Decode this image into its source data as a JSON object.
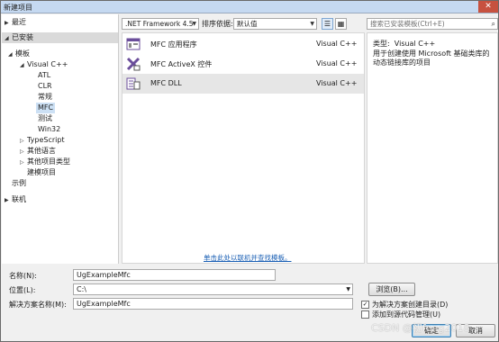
{
  "window": {
    "title": "新建项目",
    "close": "✕"
  },
  "tree": {
    "recent": "最近",
    "installed": "已安装",
    "templates": "模板",
    "visual_cpp": "Visual C++",
    "cpp_children": [
      "ATL",
      "CLR",
      "常规",
      "MFC",
      "测试",
      "Win32"
    ],
    "typescript": "TypeScript",
    "other_languages": "其他语言",
    "other_project_types": "其他项目类型",
    "modeling": "建模项目",
    "samples": "示例",
    "online": "联机"
  },
  "toolbar": {
    "framework": ".NET Framework 4.5",
    "sort_label": "排序依据:",
    "sort_value": "默认值"
  },
  "templates": [
    {
      "name": "MFC 应用程序",
      "lang": "Visual C++",
      "icon": "mfc-app-icon"
    },
    {
      "name": "MFC ActiveX 控件",
      "lang": "Visual C++",
      "icon": "mfc-activex-icon"
    },
    {
      "name": "MFC DLL",
      "lang": "Visual C++",
      "icon": "mfc-dll-icon"
    }
  ],
  "online_link": "单击此处以联机并查找模板。",
  "search": {
    "placeholder": "搜索已安装模板(Ctrl+E)"
  },
  "details": {
    "type_label": "类型:",
    "type_value": "Visual C++",
    "description": "用于创建使用 Microsoft 基础类库的动态链接库的项目"
  },
  "form": {
    "name_label": "名称(N):",
    "name_value": "UgExampleMfc",
    "location_label": "位置(L):",
    "location_value": "C:\\",
    "solution_label": "解决方案名称(M):",
    "solution_value": "UgExampleMfc",
    "browse": "浏览(B)...",
    "create_dir": "为解决方案创建目录(D)",
    "add_source_control": "添加到源代码管理(U)",
    "ok": "确定",
    "cancel": "取消"
  },
  "watermark": "CSDN @初feng2018"
}
